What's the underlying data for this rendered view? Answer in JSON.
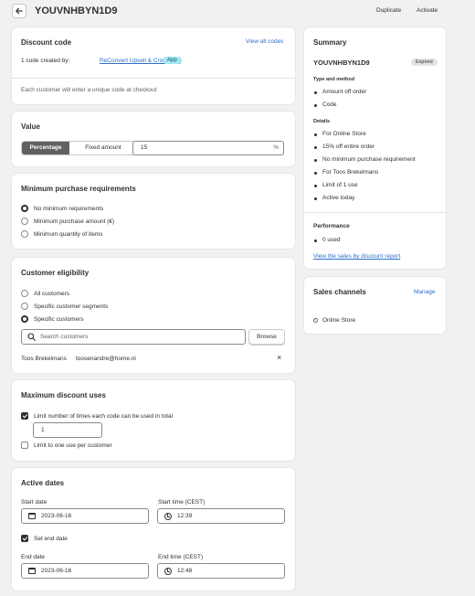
{
  "header": {
    "title": "YOUVNHBYN1D9",
    "duplicate": "Duplicate",
    "activate": "Activate"
  },
  "discount_code": {
    "heading": "Discount code",
    "view_all": "View all codes",
    "created_by_prefix": "1 code created by:",
    "creator_app": "ReConvert Upsell & Cross Sell",
    "app_badge": "App",
    "note": "Each customer will enter a unique code at checkout"
  },
  "value": {
    "heading": "Value",
    "percentage": "Percentage",
    "fixed_amount": "Fixed amount",
    "amount": "15",
    "suffix": "%"
  },
  "minimum": {
    "heading": "Minimum purchase requirements",
    "options": [
      "No minimum requirements",
      "Minimum purchase amount (€)",
      "Minimum quantity of items"
    ],
    "selected": 0
  },
  "eligibility": {
    "heading": "Customer eligibility",
    "options": [
      "All customers",
      "Specific customer segments",
      "Specific customers"
    ],
    "selected": 2,
    "search_placeholder": "Search customers",
    "browse": "Browse",
    "customer_name": "Toos Brekelmans",
    "customer_email": "toosenandre@home.nl",
    "remove": "×"
  },
  "max_uses": {
    "heading": "Maximum discount uses",
    "limit_total_label": "Limit number of times each code can be used in total",
    "limit_total_checked": true,
    "limit_total_value": "1",
    "limit_per_customer_label": "Limit to one use per customer",
    "limit_per_customer_checked": false
  },
  "dates": {
    "heading": "Active dates",
    "start_date_label": "Start date",
    "start_date": "2023-06-16",
    "start_time_label": "Start time (CEST)",
    "start_time": "12:39",
    "set_end_date_label": "Set end date",
    "set_end_date_checked": true,
    "end_date_label": "End date",
    "end_date": "2023-06-16",
    "end_time_label": "End time (CEST)",
    "end_time": "12:48"
  },
  "summary": {
    "heading": "Summary",
    "code": "YOUVNHBYN1D9",
    "status": "Expired",
    "type_heading": "Type and method",
    "type_items": [
      "Amount off order",
      "Code"
    ],
    "details_heading": "Details",
    "details_items": [
      "For Online Store",
      "15% off entire order",
      "No minimum purchase requirement",
      "For Toos Brekelmans",
      "Limit of 1 use",
      "Active today"
    ],
    "performance_heading": "Performance",
    "performance_items": [
      "0 used"
    ],
    "report_link": "View the sales by discount report"
  },
  "sales_channels": {
    "heading": "Sales channels",
    "manage": "Manage",
    "channel": "Online Store"
  },
  "colors": {
    "accent": "#2c6ecb",
    "app_badge_bg": "#a4e8f2",
    "selected_segment": "#616161",
    "expired_badge_bg": "#e3e3e3"
  }
}
